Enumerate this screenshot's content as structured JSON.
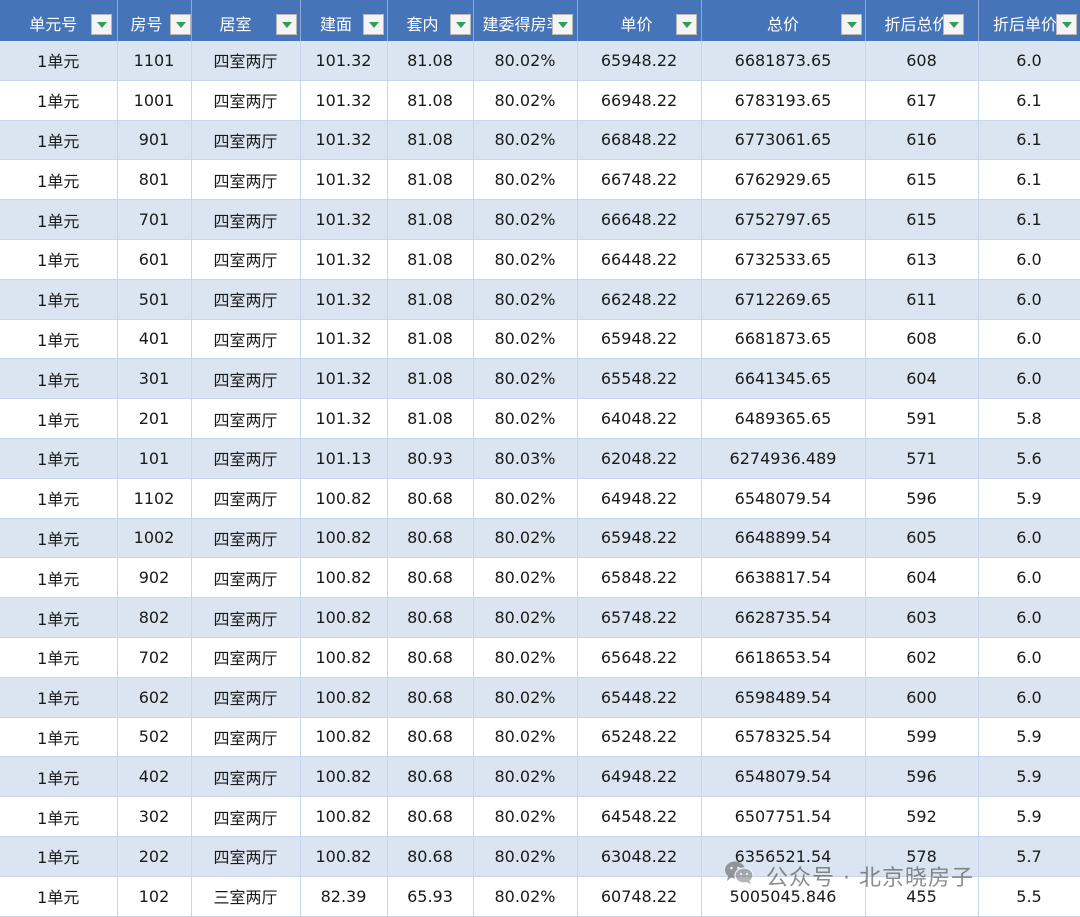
{
  "headers": [
    "单元号",
    "房号",
    "居室",
    "建面",
    "套内",
    "建委得房率",
    "单价",
    "总价",
    "折后总价",
    "折后单价"
  ],
  "rows": [
    [
      "1单元",
      "1101",
      "四室两厅",
      "101.32",
      "81.08",
      "80.02%",
      "65948.22",
      "6681873.65",
      "608",
      "6.0"
    ],
    [
      "1单元",
      "1001",
      "四室两厅",
      "101.32",
      "81.08",
      "80.02%",
      "66948.22",
      "6783193.65",
      "617",
      "6.1"
    ],
    [
      "1单元",
      "901",
      "四室两厅",
      "101.32",
      "81.08",
      "80.02%",
      "66848.22",
      "6773061.65",
      "616",
      "6.1"
    ],
    [
      "1单元",
      "801",
      "四室两厅",
      "101.32",
      "81.08",
      "80.02%",
      "66748.22",
      "6762929.65",
      "615",
      "6.1"
    ],
    [
      "1单元",
      "701",
      "四室两厅",
      "101.32",
      "81.08",
      "80.02%",
      "66648.22",
      "6752797.65",
      "615",
      "6.1"
    ],
    [
      "1单元",
      "601",
      "四室两厅",
      "101.32",
      "81.08",
      "80.02%",
      "66448.22",
      "6732533.65",
      "613",
      "6.0"
    ],
    [
      "1单元",
      "501",
      "四室两厅",
      "101.32",
      "81.08",
      "80.02%",
      "66248.22",
      "6712269.65",
      "611",
      "6.0"
    ],
    [
      "1单元",
      "401",
      "四室两厅",
      "101.32",
      "81.08",
      "80.02%",
      "65948.22",
      "6681873.65",
      "608",
      "6.0"
    ],
    [
      "1单元",
      "301",
      "四室两厅",
      "101.32",
      "81.08",
      "80.02%",
      "65548.22",
      "6641345.65",
      "604",
      "6.0"
    ],
    [
      "1单元",
      "201",
      "四室两厅",
      "101.32",
      "81.08",
      "80.02%",
      "64048.22",
      "6489365.65",
      "591",
      "5.8"
    ],
    [
      "1单元",
      "101",
      "四室两厅",
      "101.13",
      "80.93",
      "80.03%",
      "62048.22",
      "6274936.489",
      "571",
      "5.6"
    ],
    [
      "1单元",
      "1102",
      "四室两厅",
      "100.82",
      "80.68",
      "80.02%",
      "64948.22",
      "6548079.54",
      "596",
      "5.9"
    ],
    [
      "1单元",
      "1002",
      "四室两厅",
      "100.82",
      "80.68",
      "80.02%",
      "65948.22",
      "6648899.54",
      "605",
      "6.0"
    ],
    [
      "1单元",
      "902",
      "四室两厅",
      "100.82",
      "80.68",
      "80.02%",
      "65848.22",
      "6638817.54",
      "604",
      "6.0"
    ],
    [
      "1单元",
      "802",
      "四室两厅",
      "100.82",
      "80.68",
      "80.02%",
      "65748.22",
      "6628735.54",
      "603",
      "6.0"
    ],
    [
      "1单元",
      "702",
      "四室两厅",
      "100.82",
      "80.68",
      "80.02%",
      "65648.22",
      "6618653.54",
      "602",
      "6.0"
    ],
    [
      "1单元",
      "602",
      "四室两厅",
      "100.82",
      "80.68",
      "80.02%",
      "65448.22",
      "6598489.54",
      "600",
      "6.0"
    ],
    [
      "1单元",
      "502",
      "四室两厅",
      "100.82",
      "80.68",
      "80.02%",
      "65248.22",
      "6578325.54",
      "599",
      "5.9"
    ],
    [
      "1单元",
      "402",
      "四室两厅",
      "100.82",
      "80.68",
      "80.02%",
      "64948.22",
      "6548079.54",
      "596",
      "5.9"
    ],
    [
      "1单元",
      "302",
      "四室两厅",
      "100.82",
      "80.68",
      "80.02%",
      "64548.22",
      "6507751.54",
      "592",
      "5.9"
    ],
    [
      "1单元",
      "202",
      "四室两厅",
      "100.82",
      "80.68",
      "80.02%",
      "63048.22",
      "6356521.54",
      "578",
      "5.7"
    ],
    [
      "1单元",
      "102",
      "三室两厅",
      "82.39",
      "65.93",
      "80.02%",
      "60748.22",
      "5005045.846",
      "455",
      "5.5"
    ]
  ],
  "watermark": {
    "text": "公众号 · 北京晓房子",
    "icon": "wechat-icon"
  },
  "colors": {
    "header_bg": "#4674b8",
    "band": "#dbe5f1",
    "filter_arrow": "#2f9e57"
  }
}
